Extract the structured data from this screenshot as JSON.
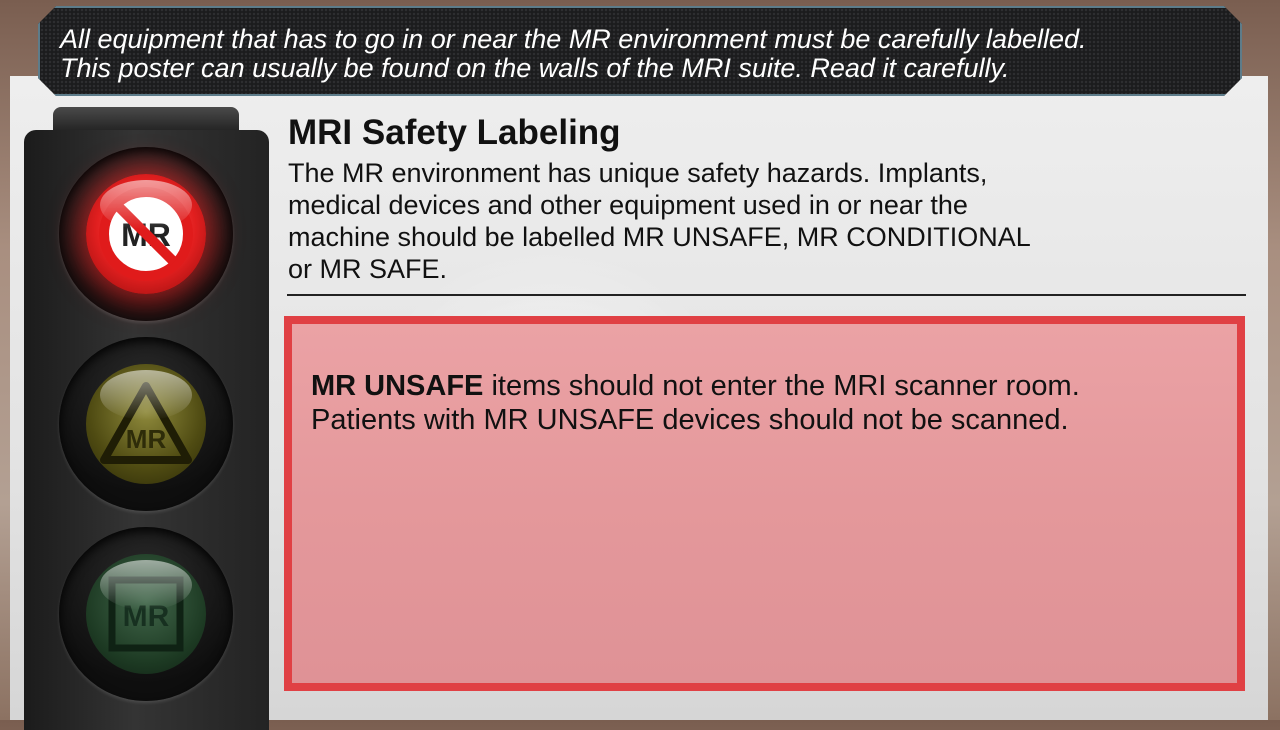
{
  "header": {
    "line1": "All equipment that has to go in or near the MR environment must be carefully labelled.",
    "line2": "This poster can usually be found on the walls of the MRI suite. Read it carefully."
  },
  "title": "MRI Safety Labeling",
  "intro": {
    "line1": "The MR environment has unique safety hazards. Implants,",
    "line2": "medical devices and other equipment used in or near the",
    "line3": "machine should be labelled MR UNSAFE, MR CONDITIONAL",
    "line4": "or MR SAFE."
  },
  "traffic_light": {
    "lamps": [
      {
        "label": "MR",
        "icon": "mr-unsafe-icon",
        "active": true
      },
      {
        "label": "MR",
        "icon": "mr-conditional-icon",
        "active": false
      },
      {
        "label": "MR",
        "icon": "mr-safe-icon",
        "active": false
      }
    ]
  },
  "info": {
    "bold": "MR UNSAFE",
    "rest": " items should not enter the MRI scanner room.",
    "line2": "Patients with MR UNSAFE devices should not be scanned."
  },
  "colors": {
    "unsafe_border": "#e04044",
    "unsafe_fill": "#e89ea1",
    "header_border": "#5d7c8a"
  }
}
